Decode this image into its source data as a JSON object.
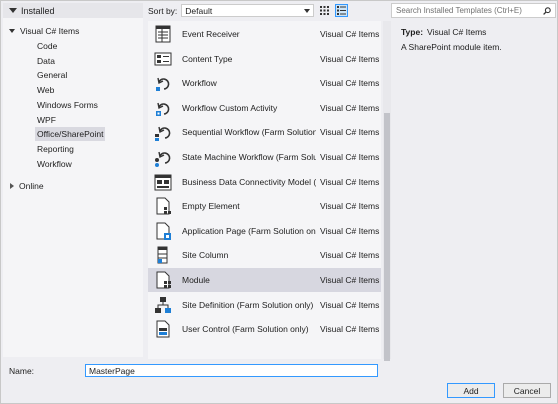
{
  "tree": {
    "installed": "Installed",
    "visual_cs": "Visual C# Items",
    "children": [
      "Code",
      "Data",
      "General",
      "Web",
      "Windows Forms",
      "WPF",
      "Office/SharePoint",
      "Reporting",
      "Workflow"
    ],
    "online": "Online"
  },
  "toolbar": {
    "sort_label": "Sort by:",
    "sort_value": "Default"
  },
  "search": {
    "placeholder": "Search Installed Templates (Ctrl+E)"
  },
  "templates": [
    {
      "name": "Event Receiver",
      "lang": "Visual C# Items",
      "icon": "event-receiver-icon"
    },
    {
      "name": "Content Type",
      "lang": "Visual C# Items",
      "icon": "content-type-icon"
    },
    {
      "name": "Workflow",
      "lang": "Visual C# Items",
      "icon": "workflow-icon"
    },
    {
      "name": "Workflow Custom Activity",
      "lang": "Visual C# Items",
      "icon": "workflow-activity-icon"
    },
    {
      "name": "Sequential Workflow (Farm Solution o...",
      "lang": "Visual C# Items",
      "icon": "sequential-workflow-icon"
    },
    {
      "name": "State Machine Workflow (Farm Solutio...",
      "lang": "Visual C# Items",
      "icon": "state-machine-workflow-icon"
    },
    {
      "name": "Business Data Connectivity Model (Far...",
      "lang": "Visual C# Items",
      "icon": "bdc-model-icon"
    },
    {
      "name": "Empty Element",
      "lang": "Visual C# Items",
      "icon": "empty-element-icon"
    },
    {
      "name": "Application Page (Farm Solution only)",
      "lang": "Visual C# Items",
      "icon": "application-page-icon"
    },
    {
      "name": "Site Column",
      "lang": "Visual C# Items",
      "icon": "site-column-icon"
    },
    {
      "name": "Module",
      "lang": "Visual C# Items",
      "icon": "module-icon"
    },
    {
      "name": "Site Definition (Farm Solution only)",
      "lang": "Visual C# Items",
      "icon": "site-definition-icon"
    },
    {
      "name": "User Control (Farm Solution only)",
      "lang": "Visual C# Items",
      "icon": "user-control-icon"
    }
  ],
  "selected_template_index": 10,
  "details": {
    "type_label": "Type:",
    "type_value": "Visual C# Items",
    "description": "A SharePoint module item."
  },
  "name_field": {
    "label": "Name:",
    "value": "MasterPage"
  },
  "buttons": {
    "add": "Add",
    "cancel": "Cancel"
  },
  "colors": {
    "accent": "#3399ff",
    "selection": "#d7d7e0",
    "panel": "#f5f5f7"
  }
}
